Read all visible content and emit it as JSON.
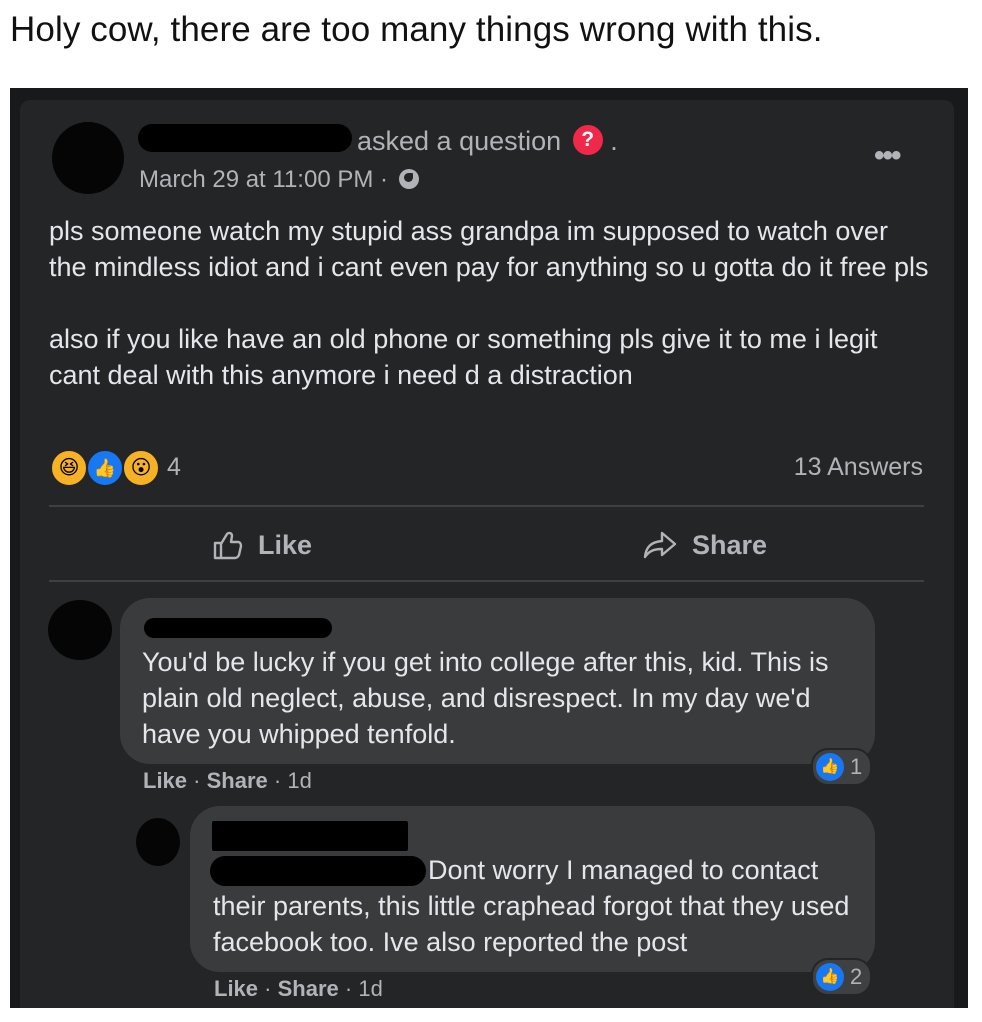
{
  "caption": "Holy cow, there are too many things wrong with this.",
  "post": {
    "action_text": "asked a question",
    "question_badge": "?",
    "trailing_dot": ".",
    "timestamp": "March 29 at 11:00 PM ·",
    "visibility_icon": "globe-icon",
    "more_icon": "•••",
    "paragraphs": [
      "pls someone watch my stupid ass grandpa im supposed to watch over the mindless idiot and i cant even pay for anything so u gotta do it free pls",
      "also if you like have an old phone or something pls give it to me i legit cant deal with this anymore i need d a distraction"
    ],
    "reaction_icons": [
      "haha-icon",
      "like-icon",
      "wow-icon"
    ],
    "reaction_count": "4",
    "answers_count": "13 Answers",
    "like_label": "Like",
    "share_label": "Share"
  },
  "comments": [
    {
      "text": "You'd be lucky if you get into college after this, kid. This is plain old neglect, abuse, and disrespect. In my day we'd have you whipped tenfold.",
      "like_label": "Like",
      "share_label": "Share",
      "age": "1d",
      "likes": "1"
    },
    {
      "text": "Dont worry I managed to contact their parents, this little craphead forgot that they used facebook too. Ive also reported the post",
      "like_label": "Like",
      "share_label": "Share",
      "age": "1d",
      "likes": "2"
    }
  ],
  "colors": {
    "background": "#18191a",
    "card": "#242526",
    "bubble": "#3a3b3c",
    "primary_text": "#e4e6eb",
    "secondary_text": "#b0b3b8",
    "like_blue": "#1877f2",
    "question_red": "#f02849"
  }
}
